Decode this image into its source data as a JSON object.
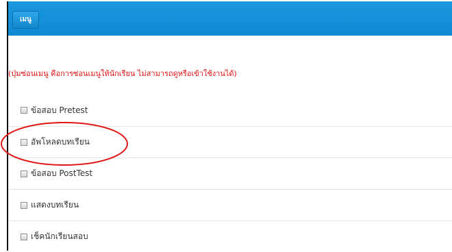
{
  "header": {
    "menu_label": "เมนู",
    "bar_color": "#1a98e0"
  },
  "note": {
    "text": "(ปุ่มซ่อนเมนู คือการซ่อนเมนูให้นักเรียน ไม่สามารถดูหรือเข้าใช้งานได้)",
    "color": "#e01414"
  },
  "menu_items": [
    {
      "label": "ข้อสอบ Pretest",
      "checked": false
    },
    {
      "label": "อัพโหลดบทเรียน",
      "checked": false
    },
    {
      "label": "ข้อสอบ PostTest",
      "checked": false
    },
    {
      "label": "แสดงบทเรียน",
      "checked": false
    },
    {
      "label": "เช็คนักเรียนสอบ",
      "checked": false
    }
  ],
  "annotation": {
    "highlighted_item": "อัพโหลดบทเรียน",
    "color": "#e01414"
  }
}
